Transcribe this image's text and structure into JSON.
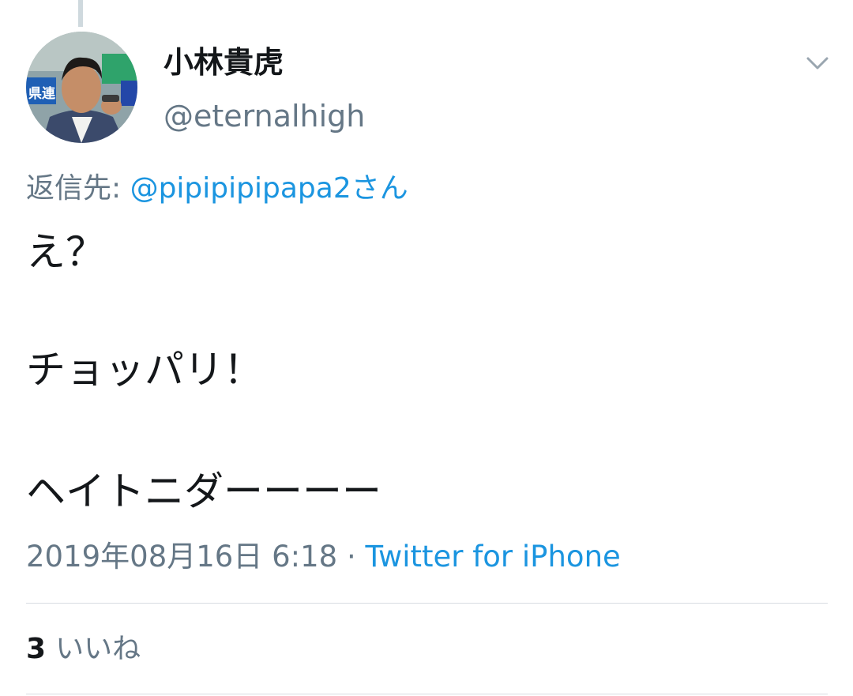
{
  "author": {
    "display_name": "小林貴虎",
    "handle": "@eternalhigh",
    "avatar_sign_text": "県連"
  },
  "reply": {
    "prefix": "返信先: ",
    "to": "@pipipipipapa2さん"
  },
  "tweet": {
    "lines": [
      "え？",
      "チョッパリ！",
      "ヘイトニダーーーー"
    ]
  },
  "meta": {
    "timestamp": "2019年08月16日 6:18",
    "separator": " · ",
    "client": "Twitter for iPhone"
  },
  "stats": {
    "likes_count": "3",
    "likes_label": "いいね"
  },
  "icons": {
    "menu": "chevron-down-icon"
  },
  "colors": {
    "link": "#1b95e0",
    "secondary_text": "#657786",
    "primary_text": "#14171a",
    "divider": "#d7dce1"
  }
}
